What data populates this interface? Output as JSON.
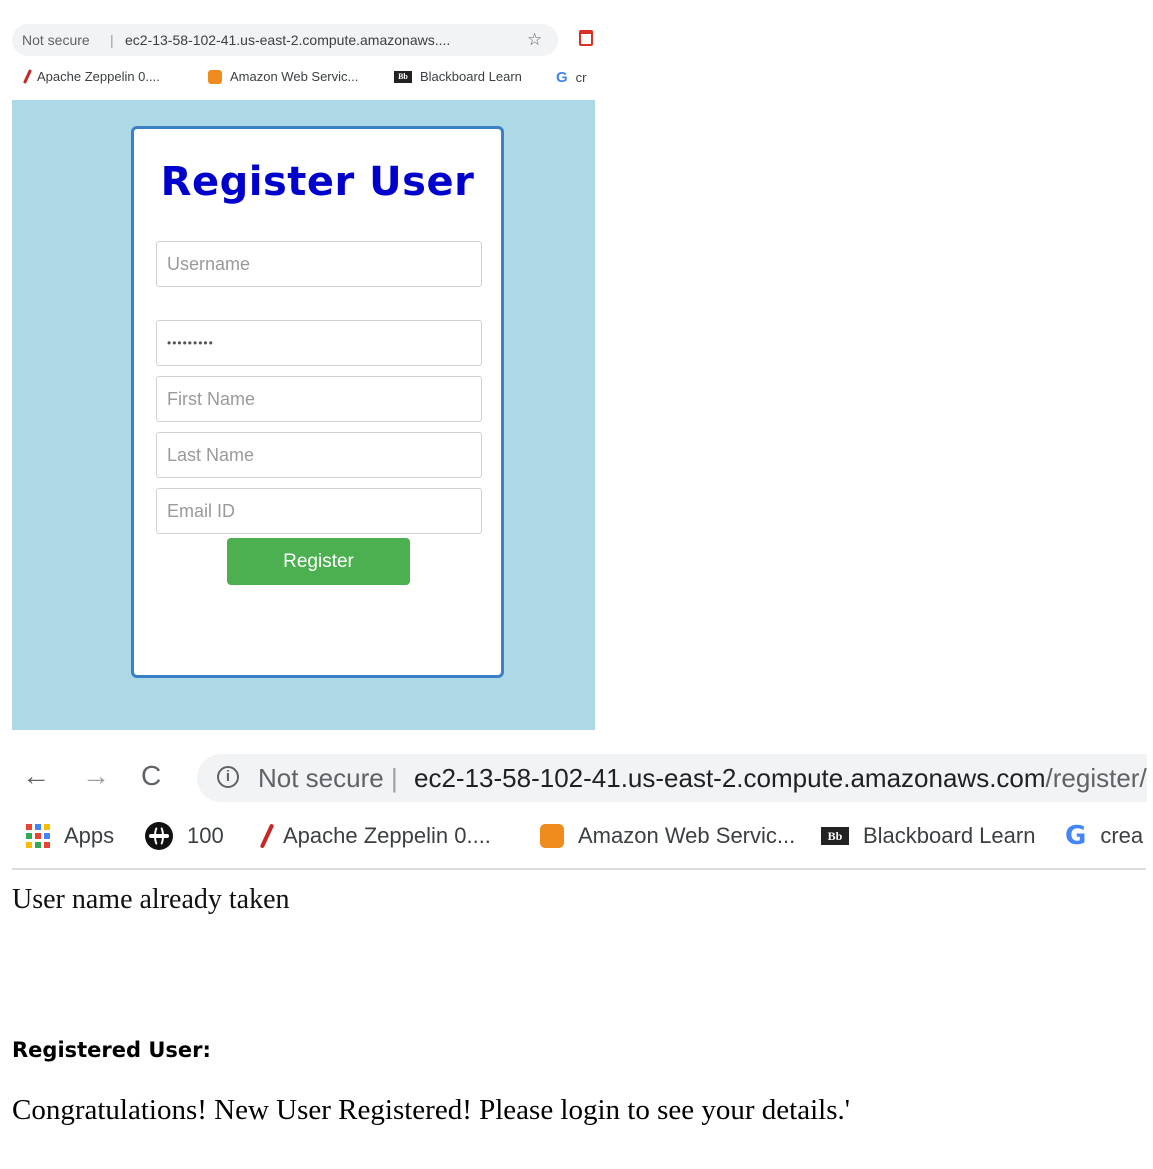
{
  "screenshot1": {
    "address_bar": {
      "not_secure": "Not secure",
      "separator": "|",
      "url": "ec2-13-58-102-41.us-east-2.compute.amazonaws...."
    },
    "bookmarks": [
      {
        "label": "Apache Zeppelin 0....",
        "icon": "feather-icon"
      },
      {
        "label": "Amazon Web Servic...",
        "icon": "aws-cube-icon"
      },
      {
        "label": "Blackboard Learn",
        "icon": "blackboard-icon",
        "icon_text": "Bb"
      },
      {
        "label": "cr",
        "icon": "google-icon",
        "icon_text": "G"
      }
    ],
    "form": {
      "title": "Register User",
      "username_placeholder": "Username",
      "password_value": "•••••••••",
      "first_name_placeholder": "First Name",
      "last_name_placeholder": "Last Name",
      "email_placeholder": "Email ID",
      "register_label": "Register"
    },
    "colors": {
      "page_bg": "#add8e6",
      "title": "#0000cc",
      "card_border": "#3b7fc4",
      "button": "#4caf50"
    }
  },
  "screenshot2": {
    "nav": {
      "back_glyph": "←",
      "forward_glyph": "→",
      "reload_glyph": "C"
    },
    "address_bar": {
      "info_glyph": "i",
      "not_secure": "Not secure",
      "separator": "|",
      "host": "ec2-13-58-102-41.us-east-2.compute.amazonaws.com",
      "path": "/register/"
    },
    "bookmarks": [
      {
        "label": "Apps",
        "icon": "apps-grid-icon"
      },
      {
        "label": "100",
        "icon": "globe-icon"
      },
      {
        "label": "Apache Zeppelin 0....",
        "icon": "feather-icon"
      },
      {
        "label": "Amazon Web Servic...",
        "icon": "aws-cube-icon"
      },
      {
        "label": "Blackboard Learn",
        "icon": "blackboard-icon",
        "icon_text": "Bb"
      },
      {
        "label": "crea",
        "icon": "google-icon",
        "icon_text": "G"
      }
    ],
    "response_text": "User name already taken"
  },
  "document": {
    "heading": "Registered User:",
    "message": "Congratulations! New User Registered! Please login to see your details.'"
  }
}
